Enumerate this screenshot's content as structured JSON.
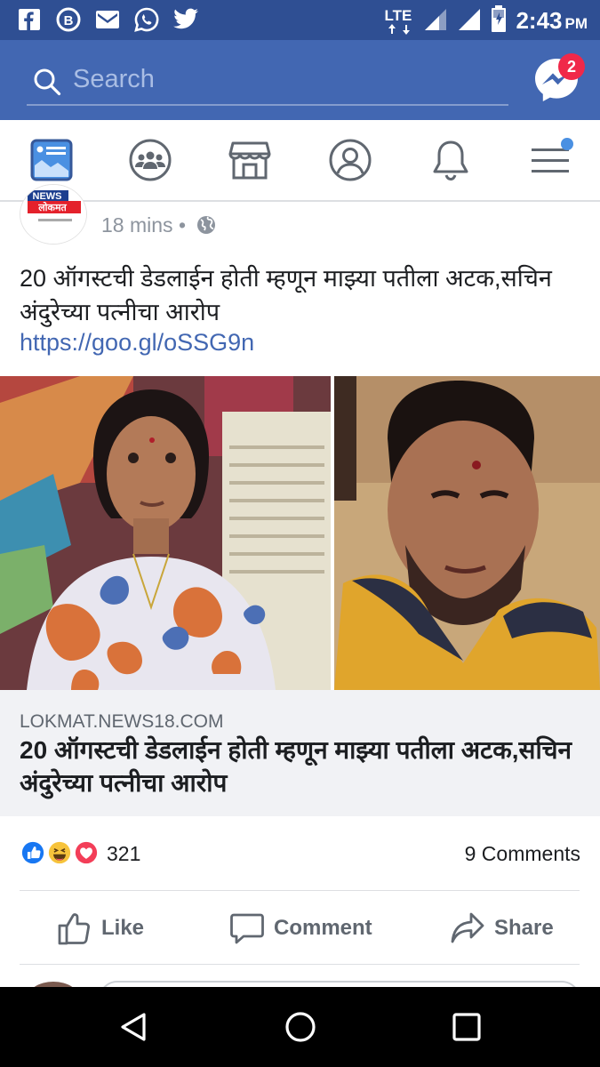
{
  "status_bar": {
    "notification_icons": [
      "facebook-icon",
      "bbm-icon",
      "gmail-icon",
      "whatsapp-icon",
      "twitter-icon"
    ],
    "network": "LTE",
    "time": "2:43",
    "ampm": "PM"
  },
  "header": {
    "search_placeholder": "Search",
    "messenger_badge": "2"
  },
  "tabs": [
    "news-feed-tab",
    "groups-tab",
    "marketplace-tab",
    "profile-tab",
    "notifications-tab",
    "menu-tab"
  ],
  "post": {
    "time_ago": "18 mins",
    "separator": "•",
    "text": "20 ऑगस्टची डेडलाईन होती म्हणून माझ्या पतीला अटक,सचिन अंदुरेच्या पत्नीचा आरोप",
    "link": "https://goo.gl/oSSG9n",
    "link_preview": {
      "domain": "LOKMAT.NEWS18.COM",
      "title": "20 ऑगस्टची डेडलाईन होती म्हणून माझ्या पतीला अटक,सचिन अंदुरेच्या पत्नीचा आरोप"
    },
    "reactions": {
      "types": [
        "like",
        "haha",
        "love"
      ],
      "count": "321"
    },
    "comments": "9 Comments",
    "actions": {
      "like": "Like",
      "comment": "Comment",
      "share": "Share"
    }
  },
  "colors": {
    "status_bar": "#2f4f93",
    "header": "#4267b2",
    "link": "#4267b2",
    "badge": "#f02849"
  }
}
